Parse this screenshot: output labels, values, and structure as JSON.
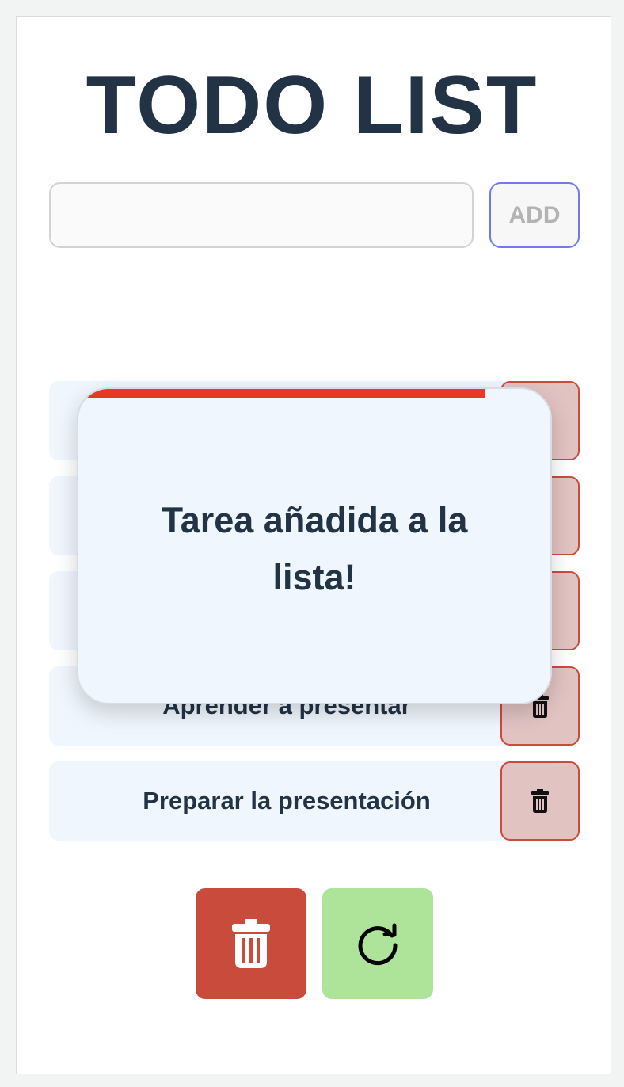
{
  "app": {
    "title": "TODO LIST"
  },
  "form": {
    "input_value": "",
    "input_placeholder": "",
    "add_label": "ADD"
  },
  "todos": [
    {
      "text": "",
      "delete_icon": "trash-icon"
    },
    {
      "text": "",
      "delete_icon": "trash-icon"
    },
    {
      "text": "",
      "delete_icon": "trash-icon"
    },
    {
      "text": "Aprender a presentar",
      "delete_icon": "trash-icon"
    },
    {
      "text": "Preparar la presentación",
      "delete_icon": "trash-icon"
    }
  ],
  "actions": {
    "clear_icon": "trash-icon",
    "refresh_icon": "refresh-icon"
  },
  "toast": {
    "message": "Tarea añadida a la lista!",
    "progress": 0.86
  },
  "colors": {
    "heading": "#223346",
    "delete_bg": "#e1c3c2",
    "delete_border": "#cb4b3e",
    "clear_bg": "#c84b3c",
    "refresh_bg": "#aee499",
    "toast_progress": "#e53a2a",
    "add_border": "#6f7be6"
  }
}
